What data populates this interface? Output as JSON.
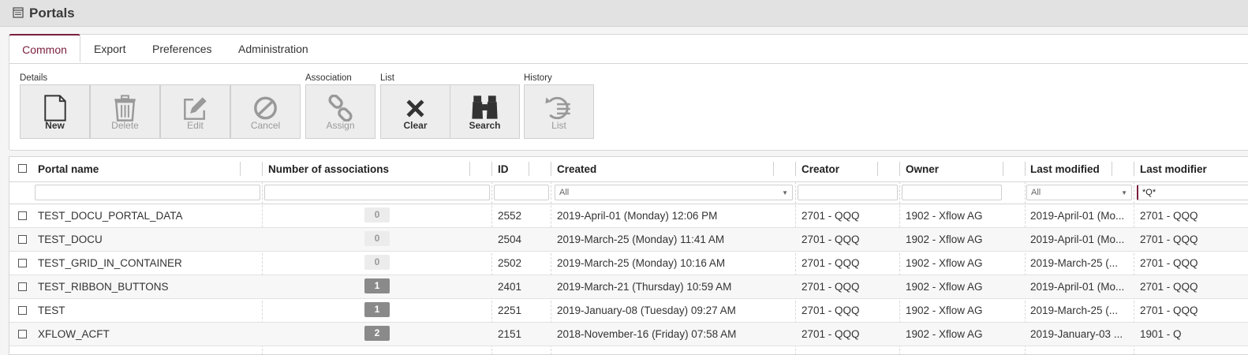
{
  "window": {
    "title": "Portals",
    "icon": "portal-window-icon"
  },
  "tabs": [
    "Common",
    "Export",
    "Preferences",
    "Administration"
  ],
  "ribbon": {
    "groups": [
      "Details",
      "Association",
      "List",
      "History"
    ],
    "buttons": [
      {
        "label": "New",
        "icon": "new-document-icon",
        "enabled": true
      },
      {
        "label": "Delete",
        "icon": "trash-icon",
        "enabled": false
      },
      {
        "label": "Edit",
        "icon": "edit-icon",
        "enabled": false
      },
      {
        "label": "Cancel",
        "icon": "cancel-icon",
        "enabled": false
      },
      {
        "label": "Assign",
        "icon": "link-icon",
        "enabled": false
      },
      {
        "label": "Clear",
        "icon": "clear-x-icon",
        "enabled": true
      },
      {
        "label": "Search",
        "icon": "binoculars-icon",
        "enabled": true
      },
      {
        "label": "List",
        "icon": "history-list-icon",
        "enabled": false
      }
    ]
  },
  "grid": {
    "columns": [
      "Portal name",
      "Number of associations",
      "ID",
      "Created",
      "Creator",
      "Owner",
      "Last modified",
      "Last modifier"
    ],
    "filters": {
      "created": "All",
      "last_modified": "All",
      "last_modifier": "*Q*"
    },
    "rows": [
      {
        "name": "TEST_DOCU_PORTAL_DATA",
        "assoc": "0",
        "id": "2552",
        "created": "2019-April-01 (Monday) 12:06 PM",
        "creator": "2701 - QQQ",
        "owner": "1902 - Xflow AG",
        "last_modified": "2019-April-01 (Mo...",
        "last_modifier": "2701 - QQQ"
      },
      {
        "name": "TEST_DOCU",
        "assoc": "0",
        "id": "2504",
        "created": "2019-March-25 (Monday) 11:41 AM",
        "creator": "2701 - QQQ",
        "owner": "1902 - Xflow AG",
        "last_modified": "2019-April-01 (Mo...",
        "last_modifier": "2701 - QQQ"
      },
      {
        "name": "TEST_GRID_IN_CONTAINER",
        "assoc": "0",
        "id": "2502",
        "created": "2019-March-25 (Monday) 10:16 AM",
        "creator": "2701 - QQQ",
        "owner": "1902 - Xflow AG",
        "last_modified": "2019-March-25 (...",
        "last_modifier": "2701 - QQQ"
      },
      {
        "name": "TEST_RIBBON_BUTTONS",
        "assoc": "1",
        "id": "2401",
        "created": "2019-March-21 (Thursday) 10:59 AM",
        "creator": "2701 - QQQ",
        "owner": "1902 - Xflow AG",
        "last_modified": "2019-April-01 (Mo...",
        "last_modifier": "2701 - QQQ"
      },
      {
        "name": "TEST",
        "assoc": "1",
        "id": "2251",
        "created": "2019-January-08 (Tuesday) 09:27 AM",
        "creator": "2701 - QQQ",
        "owner": "1902 - Xflow AG",
        "last_modified": "2019-March-25 (...",
        "last_modifier": "2701 - QQQ"
      },
      {
        "name": "XFLOW_ACFT",
        "assoc": "2",
        "id": "2151",
        "created": "2018-November-16 (Friday) 07:58 AM",
        "creator": "2701 - QQQ",
        "owner": "1902 - Xflow AG",
        "last_modified": "2019-January-03 ...",
        "last_modifier": "1901 - Q"
      }
    ]
  }
}
